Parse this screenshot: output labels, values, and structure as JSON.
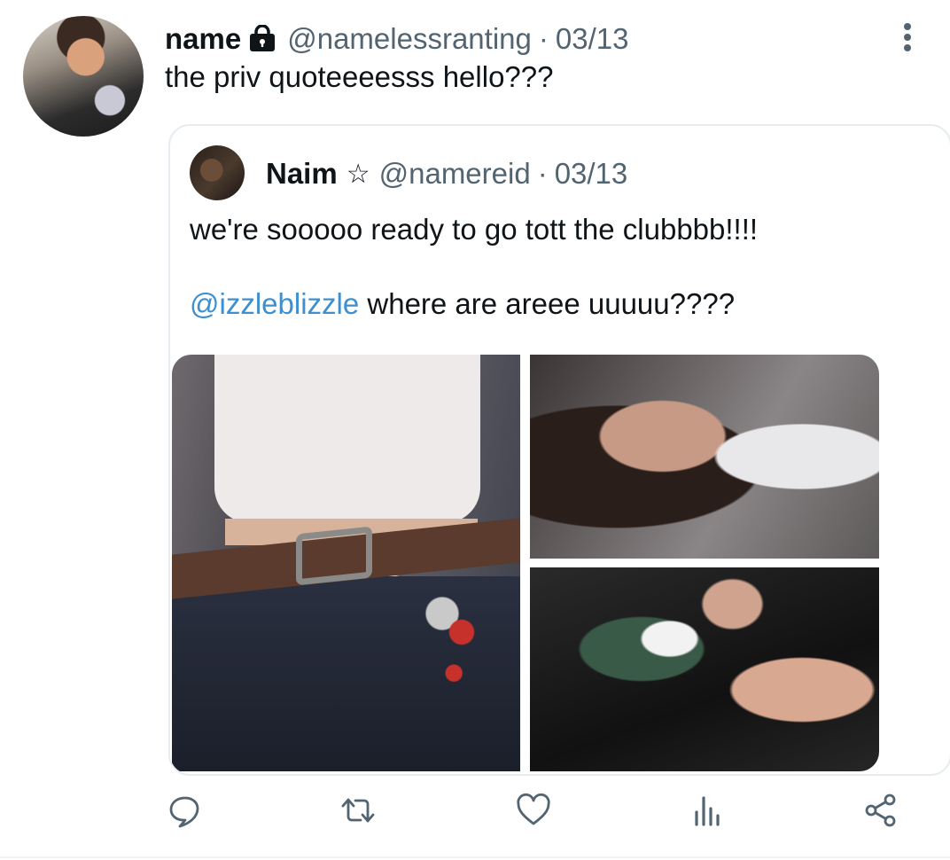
{
  "tweet": {
    "author": {
      "display_name": "name",
      "handle": "@namelessranting",
      "separator": "·",
      "date": "03/13",
      "protected_icon": "lock-icon"
    },
    "text": "the priv quoteeeesss hello???",
    "more_icon": "more-vertical-icon"
  },
  "quoted": {
    "author": {
      "display_name": "Naim",
      "badge": "☆",
      "handle": "@namereid",
      "separator": "·",
      "date": "03/13"
    },
    "line1": "we're sooooo ready to go tott the clubbbb!!!!",
    "mention": "@izzleblizzle",
    "line2_rest": " where are areee uuuuu????",
    "media_count": 3
  },
  "actions": {
    "reply_icon": "reply-icon",
    "retweet_icon": "retweet-icon",
    "like_icon": "heart-icon",
    "views_icon": "views-icon",
    "share_icon": "share-icon"
  },
  "colors": {
    "text": "#0f1419",
    "secondary": "#536471",
    "mention": "#3e8fd0",
    "border": "#e6ecf0",
    "icon": "#536471"
  }
}
